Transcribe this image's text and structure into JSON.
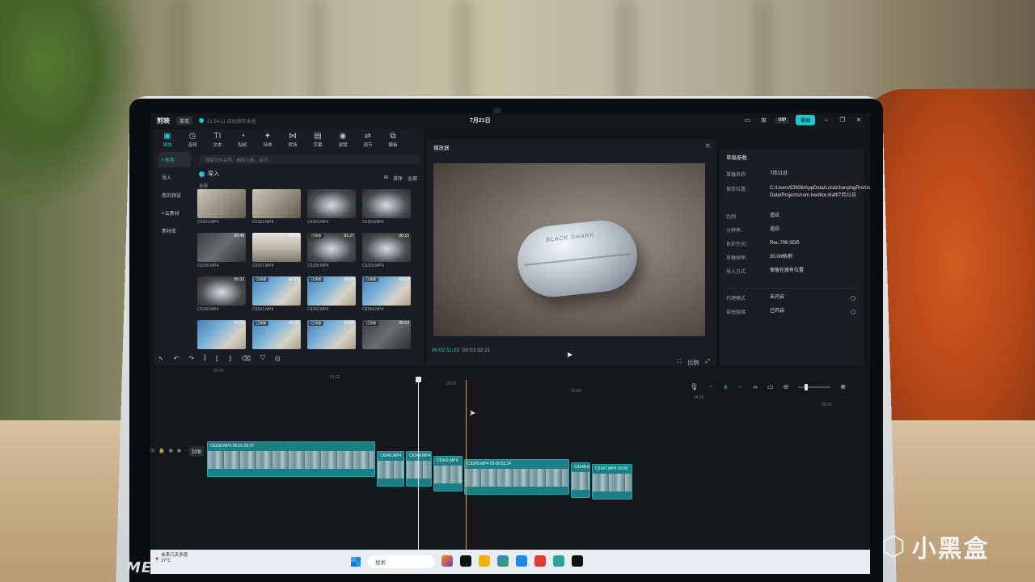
{
  "app": {
    "logo": "剪映",
    "menu": "菜单",
    "autosave": "21:54:11 自动保存本地",
    "project_title": "7月21日",
    "vip": "VIP",
    "export": "导出"
  },
  "toolbar": [
    {
      "icon": "media-icon",
      "glyph": "▣",
      "label": "媒体"
    },
    {
      "icon": "audio-icon",
      "glyph": "◷",
      "label": "音频"
    },
    {
      "icon": "text-icon",
      "glyph": "TI",
      "label": "文本"
    },
    {
      "icon": "sticker-icon",
      "glyph": "◔",
      "label": "贴纸"
    },
    {
      "icon": "effects-icon",
      "glyph": "✦",
      "label": "特效"
    },
    {
      "icon": "transition-icon",
      "glyph": "⋈",
      "label": "转场"
    },
    {
      "icon": "caption-icon",
      "glyph": "▤",
      "label": "字幕"
    },
    {
      "icon": "filter-icon",
      "glyph": "◉",
      "label": "滤镜"
    },
    {
      "icon": "adjust-icon",
      "glyph": "⇌",
      "label": "调节"
    },
    {
      "icon": "template-icon",
      "glyph": "⧉",
      "label": "模板"
    }
  ],
  "sidebar": [
    {
      "label": "• 本地",
      "active": true
    },
    {
      "label": "导入",
      "active": false
    },
    {
      "label": "我的预设",
      "active": false
    },
    {
      "label": "• 云素材",
      "active": false
    },
    {
      "label": "素材库",
      "active": false
    }
  ],
  "media": {
    "search_placeholder": "搜索文件名称、画面元素、台词",
    "import_label": "导入",
    "sort_label": "排序",
    "filter_label": "全部",
    "all_label": "全部",
    "clips": [
      {
        "label": "C6331.MP4",
        "duration": "",
        "badge": "",
        "style": "t-room"
      },
      {
        "label": "C6332.MP4",
        "duration": "",
        "badge": "",
        "style": "t-room"
      },
      {
        "label": "C6333.MP4",
        "duration": "",
        "badge": "",
        "style": "t-case"
      },
      {
        "label": "C6334.MP4",
        "duration": "",
        "badge": "",
        "style": "t-case"
      },
      {
        "label": "C6336.MP4",
        "duration": "00:40",
        "badge": "",
        "style": "t-dark"
      },
      {
        "label": "C6337.MP4",
        "duration": "00:55",
        "badge": "",
        "style": "t-desk"
      },
      {
        "label": "C6338.MP4",
        "duration": "01:27",
        "badge": "已添加",
        "style": "t-case"
      },
      {
        "label": "C6339.MP4",
        "duration": "00:15",
        "badge": "",
        "style": "t-case"
      },
      {
        "label": "C6340.MP4",
        "duration": "00:32",
        "badge": "",
        "style": "t-case"
      },
      {
        "label": "C6341.MP4",
        "duration": "00:15",
        "badge": "已添加",
        "style": "t-hand"
      },
      {
        "label": "C6342.MP4",
        "duration": "00:16",
        "badge": "已添加",
        "style": "t-hand"
      },
      {
        "label": "C6344.MP4",
        "duration": "00:14",
        "badge": "已添加",
        "style": "t-hand"
      },
      {
        "label": "",
        "duration": "00:19",
        "badge": "",
        "style": "t-hand"
      },
      {
        "label": "",
        "duration": "00:21",
        "badge": "已添加",
        "style": "t-hand"
      },
      {
        "label": "",
        "duration": "00:10",
        "badge": "已添加",
        "style": "t-hand"
      },
      {
        "label": "",
        "duration": "00:53",
        "badge": "已添加",
        "style": "t-dark"
      }
    ]
  },
  "player": {
    "title": "播放器",
    "current_time": "00:02:11:23",
    "total_time": "00:03:32:21",
    "ratio_label": "比例",
    "case_logo": "BLACK SHARK"
  },
  "properties": {
    "title": "草稿参数",
    "rows": [
      {
        "label": "草稿名称:",
        "value": "7月21日"
      },
      {
        "label": "保存位置:",
        "value": "C:/Users/53936/AppData/Local/JianyingPro/User Data/Projects/com.lveditor.draft/7月21日"
      },
      {
        "label": "比例:",
        "value": "适应"
      },
      {
        "label": "分辨率:",
        "value": "适应"
      },
      {
        "label": "色彩空间:",
        "value": "Rec.709 SDR"
      },
      {
        "label": "草稿帧率:",
        "value": "30.00帧/秒"
      },
      {
        "label": "导入方式:",
        "value": "保留在原有位置"
      }
    ],
    "proxy_label": "代理模式",
    "proxy_value": "未开启",
    "free_layer_label": "自由层级",
    "free_layer_value": "已开启",
    "modify": "修改"
  },
  "timeline": {
    "ruler": [
      "00:00",
      "01:00",
      "02:00",
      "03:00",
      "04:00",
      "05:00"
    ],
    "cover": "封面",
    "clips": [
      {
        "label": "C6338.MP4  00:01:26:27"
      },
      {
        "label": "C6341.MP4"
      },
      {
        "label": "C6344.MP4"
      },
      {
        "label": "C6342.MP4"
      },
      {
        "label": "C6349.MP4  00:00:52:24"
      },
      {
        "label": "C6348.M"
      },
      {
        "label": "C6347.MP4  00:00"
      }
    ]
  },
  "taskbar": {
    "weather_title": "未来几天多雨",
    "weather_temp": "27°C",
    "search": "搜索"
  },
  "device_brand": "METAPHYUNI",
  "watermark": "小黑盒"
}
